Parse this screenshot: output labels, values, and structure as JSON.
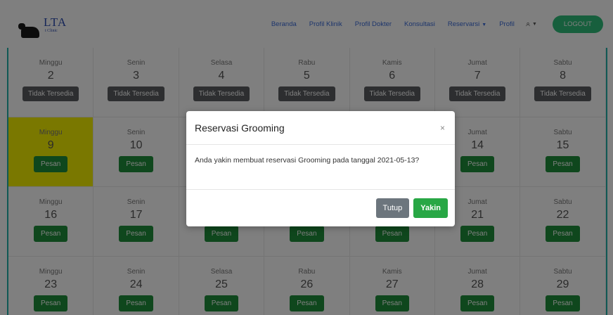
{
  "navbar": {
    "logo_text": "LTA",
    "logo_sub": "t Clinic",
    "links": [
      "Beranda",
      "Profil Klinik",
      "Profil Dokter",
      "Konsultasi",
      "Reservarsi",
      "Profil"
    ],
    "logout": "LOGOUT"
  },
  "calendar": {
    "rows": [
      [
        {
          "day": "Minggu",
          "date": "2",
          "action": "Tidak Tersedia"
        },
        {
          "day": "Senin",
          "date": "3",
          "action": "Tidak Tersedia"
        },
        {
          "day": "Selasa",
          "date": "4",
          "action": "Tidak Tersedia"
        },
        {
          "day": "Rabu",
          "date": "5",
          "action": "Tidak Tersedia"
        },
        {
          "day": "Kamis",
          "date": "6",
          "action": "Tidak Tersedia"
        },
        {
          "day": "Jumat",
          "date": "7",
          "action": "Tidak Tersedia"
        },
        {
          "day": "Sabtu",
          "date": "8",
          "action": "Tidak Tersedia"
        }
      ],
      [
        {
          "day": "Minggu",
          "date": "9",
          "action": "Pesan"
        },
        {
          "day": "Senin",
          "date": "10",
          "action": "Pesan"
        },
        {
          "day": "Selasa",
          "date": "11",
          "action": "Pesan"
        },
        {
          "day": "Rabu",
          "date": "12",
          "action": "Pesan"
        },
        {
          "day": "Kamis",
          "date": "13",
          "action": "Pesan"
        },
        {
          "day": "Jumat",
          "date": "14",
          "action": "Pesan"
        },
        {
          "day": "Sabtu",
          "date": "15",
          "action": "Pesan"
        }
      ],
      [
        {
          "day": "Minggu",
          "date": "16",
          "action": "Pesan"
        },
        {
          "day": "Senin",
          "date": "17",
          "action": "Pesan"
        },
        {
          "day": "Selasa",
          "date": "18",
          "action": "Pesan"
        },
        {
          "day": "Rabu",
          "date": "19",
          "action": "Pesan"
        },
        {
          "day": "Kamis",
          "date": "20",
          "action": "Pesan"
        },
        {
          "day": "Jumat",
          "date": "21",
          "action": "Pesan"
        },
        {
          "day": "Sabtu",
          "date": "22",
          "action": "Pesan"
        }
      ],
      [
        {
          "day": "Minggu",
          "date": "23",
          "action": "Pesan"
        },
        {
          "day": "Senin",
          "date": "24",
          "action": "Pesan"
        },
        {
          "day": "Selasa",
          "date": "25",
          "action": "Pesan"
        },
        {
          "day": "Rabu",
          "date": "26",
          "action": "Pesan"
        },
        {
          "day": "Kamis",
          "date": "27",
          "action": "Pesan"
        },
        {
          "day": "Jumat",
          "date": "28",
          "action": "Pesan"
        },
        {
          "day": "Sabtu",
          "date": "29",
          "action": "Pesan"
        }
      ]
    ],
    "highlight_color": "#f5f000"
  },
  "modal": {
    "title": "Reservasi Grooming",
    "close": "×",
    "message": "Anda yakin membuat reservasi Grooming pada tanggal 2021-05-13?",
    "cancel": "Tutup",
    "confirm": "Yakin"
  }
}
